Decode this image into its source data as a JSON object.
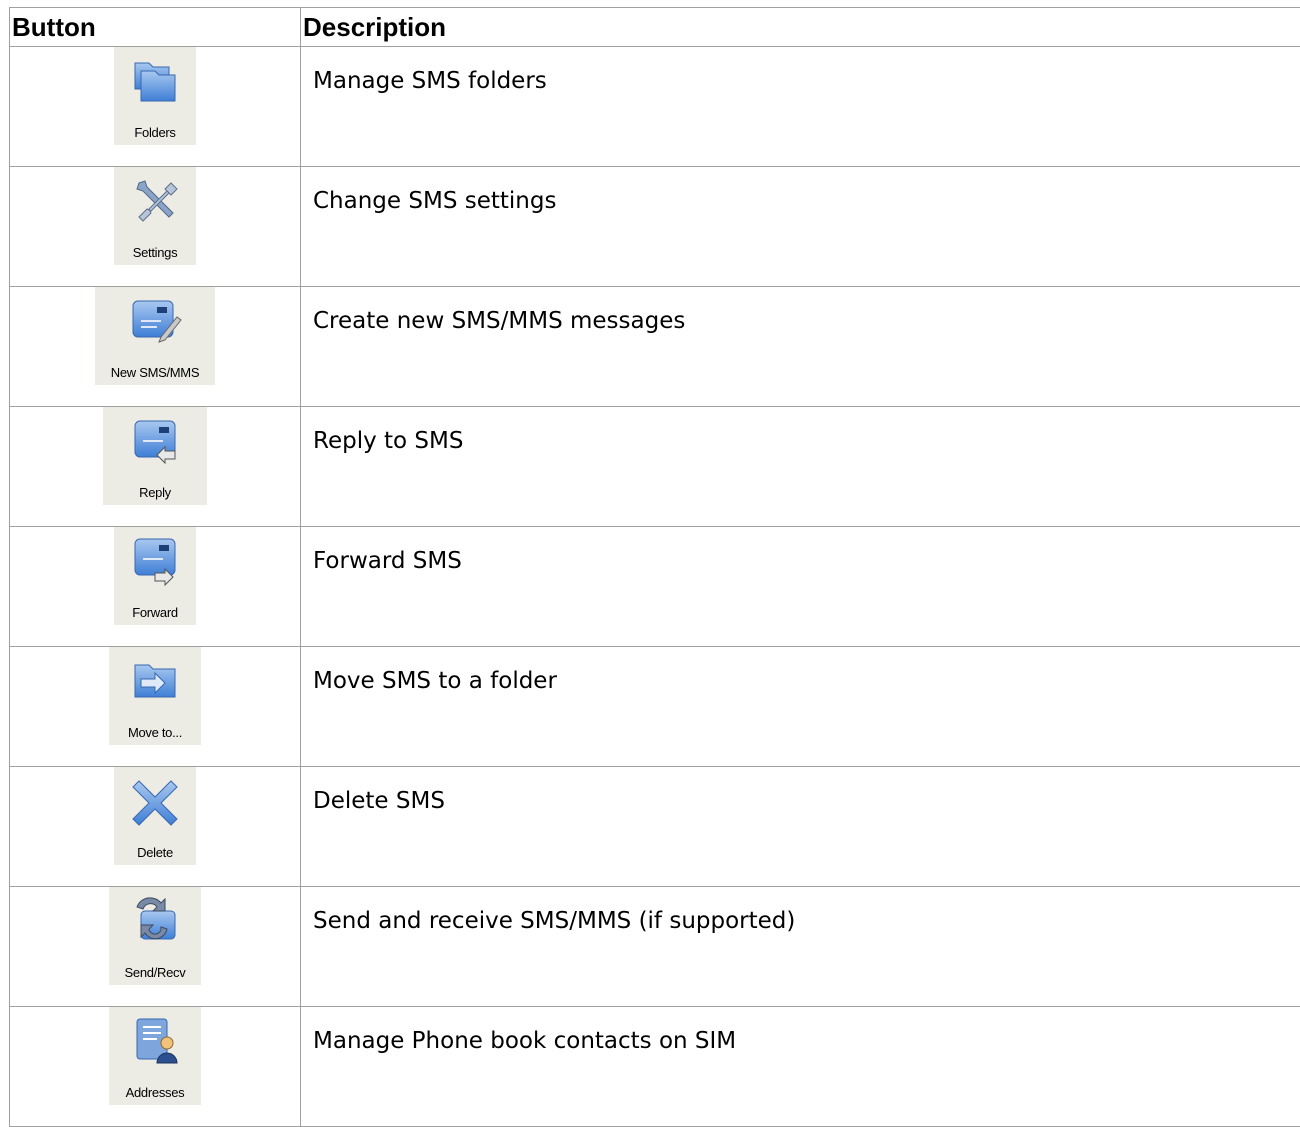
{
  "table": {
    "headers": {
      "button": "Button",
      "description": "Description"
    },
    "rows": [
      {
        "caption": "Folders",
        "icon": "folders-icon",
        "description": "Manage SMS folders"
      },
      {
        "caption": "Settings",
        "icon": "settings-icon",
        "description": "Change SMS settings"
      },
      {
        "caption": "New SMS/MMS",
        "icon": "new-message-icon",
        "description": "Create new SMS/MMS messages"
      },
      {
        "caption": "Reply",
        "icon": "reply-icon",
        "description": "Reply to SMS"
      },
      {
        "caption": "Forward",
        "icon": "forward-icon",
        "description": "Forward SMS"
      },
      {
        "caption": "Move to...",
        "icon": "move-to-folder-icon",
        "description": "Move SMS to a folder"
      },
      {
        "caption": "Delete",
        "icon": "delete-icon",
        "description": "Delete SMS"
      },
      {
        "caption": "Send/Recv",
        "icon": "send-receive-icon",
        "description": "Send and receive SMS/MMS (if supported)"
      },
      {
        "caption": "Addresses",
        "icon": "addresses-icon",
        "description": "Manage Phone book contacts on SIM"
      }
    ]
  },
  "colors": {
    "icon_blue": "#3f7fd6",
    "button_bg": "#ecebe4",
    "border": "#a0a0a0"
  }
}
